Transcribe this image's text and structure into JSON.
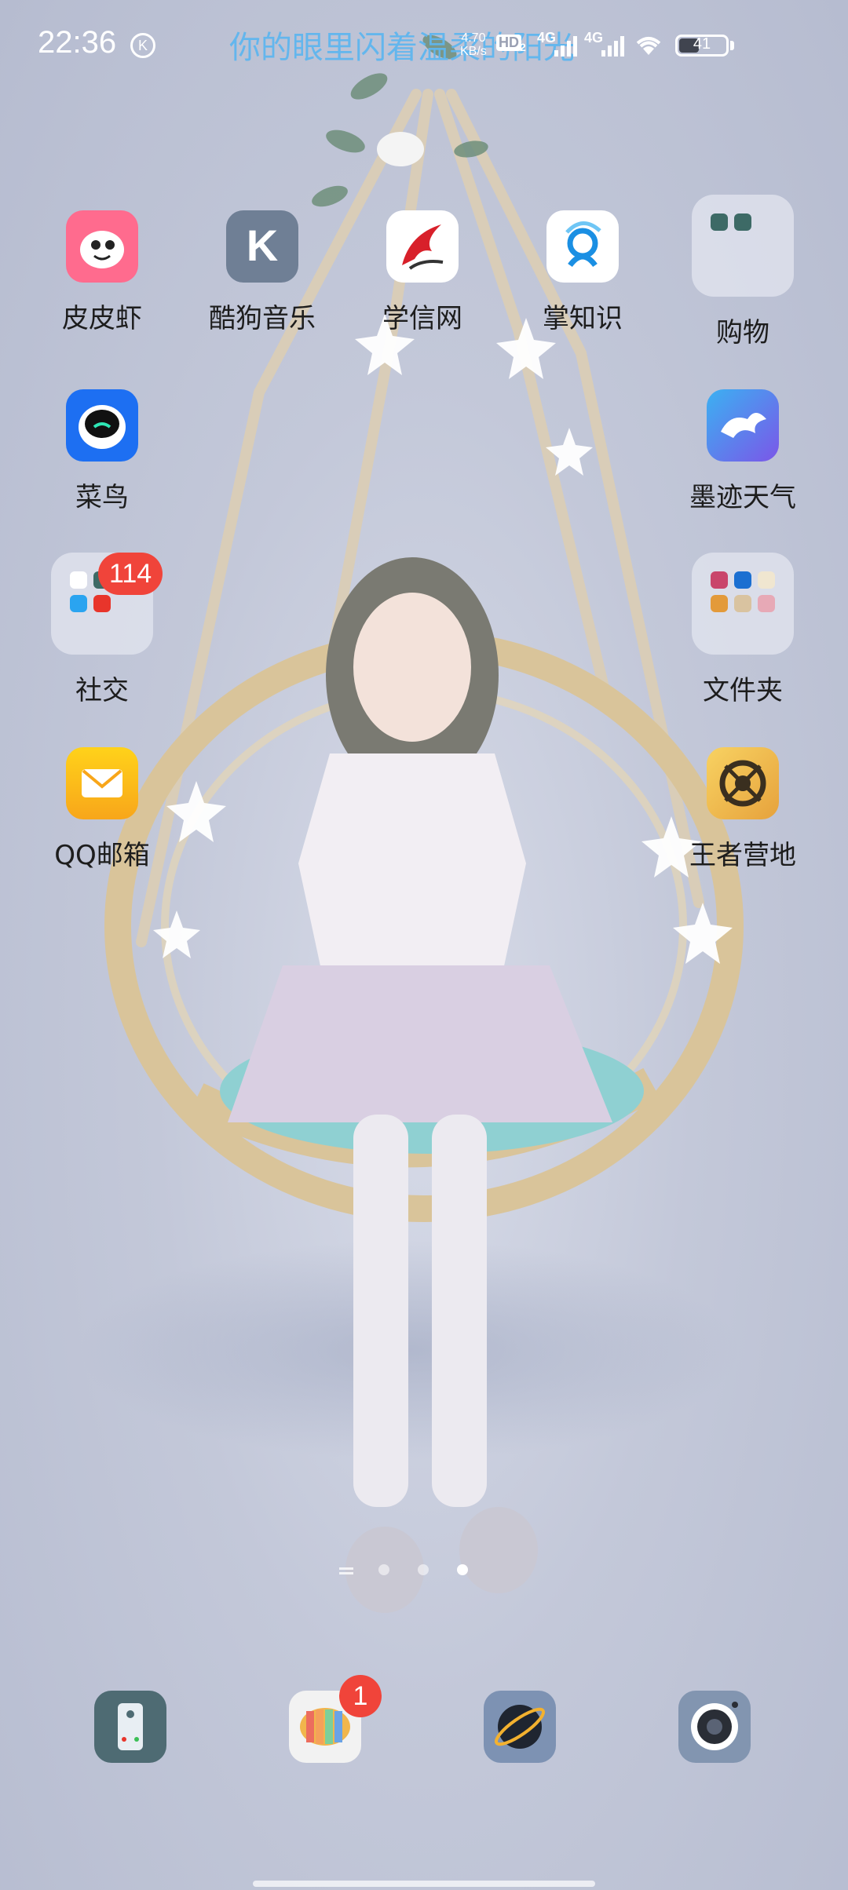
{
  "status_bar": {
    "time": "22:36",
    "k_icon": "K",
    "lyric": "你的眼里闪着温柔的阳光",
    "net_speed": "4.70",
    "net_speed_unit": "KB/s",
    "hd_label": "HD",
    "hd_sim": "2",
    "net1": "4G",
    "net2": "4G",
    "battery": "41"
  },
  "apps": [
    {
      "label": "皮皮虾",
      "icon": "pipixia-icon",
      "color": "#ff6b8e"
    },
    {
      "label": "酷狗音乐",
      "icon": "kugou-music-icon",
      "color": "#6f7f95"
    },
    {
      "label": "学信网",
      "icon": "xuexin-icon",
      "color": "#ffffff"
    },
    {
      "label": "掌知识",
      "icon": "zhangzhishi-icon",
      "color": "#ffffff"
    },
    {
      "label": "购物",
      "icon": "shopping-folder-icon"
    },
    {
      "label": "菜鸟",
      "icon": "cainiao-icon",
      "color": "#1d6ff2"
    },
    {
      "label": "墨迹天气",
      "icon": "moji-weather-icon",
      "color": "#5a6ee8"
    },
    {
      "label": "社交",
      "icon": "social-folder-icon",
      "badge": "114"
    },
    {
      "label": "文件夹",
      "icon": "folder-icon"
    },
    {
      "label": "QQ邮箱",
      "icon": "qq-mail-icon",
      "color": "#ffd21a"
    },
    {
      "label": "王者营地",
      "icon": "wangzhe-camp-icon",
      "color": "#f6c24a"
    }
  ],
  "dock": [
    {
      "icon": "phone-icon",
      "color": "#4e6b73"
    },
    {
      "icon": "messages-icon",
      "badge": "1",
      "color": "#f2f2f2"
    },
    {
      "icon": "browser-icon",
      "color": "#7d92b3"
    },
    {
      "icon": "camera-icon",
      "color": "#8295b0"
    }
  ]
}
